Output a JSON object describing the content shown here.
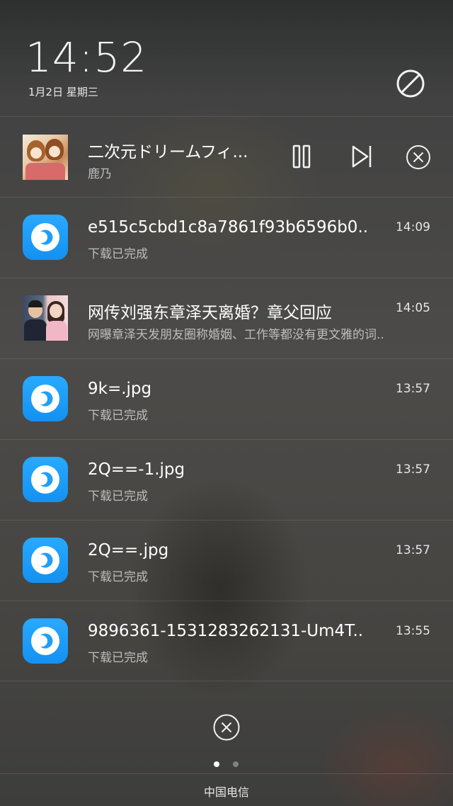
{
  "status": {
    "time": "14:52",
    "date": "1月2日 星期三"
  },
  "music": {
    "title": "二次元ドリームフィ...",
    "artist": "鹿乃"
  },
  "notifications": [
    {
      "icon": "download-app-icon",
      "title": "e515c5cbd1c8a7861f93b6596b0..",
      "subtitle": "下载已完成",
      "time": "14:09"
    },
    {
      "icon": "news-thumbnail",
      "title": "网传刘强东章泽天离婚？章父回应",
      "subtitle": "网曝章泽天发朋友圈称婚姻、工作等都没有更文雅的词..",
      "time": "14:05"
    },
    {
      "icon": "download-app-icon",
      "title": "9k=.jpg",
      "subtitle": "下载已完成",
      "time": "13:57"
    },
    {
      "icon": "download-app-icon",
      "title": "2Q==-1.jpg",
      "subtitle": "下载已完成",
      "time": "13:57"
    },
    {
      "icon": "download-app-icon",
      "title": "2Q==.jpg",
      "subtitle": "下载已完成",
      "time": "13:57"
    },
    {
      "icon": "download-app-icon",
      "title": "9896361-1531283262131-Um4T..",
      "subtitle": "下载已完成",
      "time": "13:55"
    }
  ],
  "footer": {
    "carrier": "中国电信"
  },
  "colors": {
    "app_icon_blue": "#1f9ff8",
    "text_primary": "#ffffff",
    "text_secondary": "#bdbdbd"
  }
}
